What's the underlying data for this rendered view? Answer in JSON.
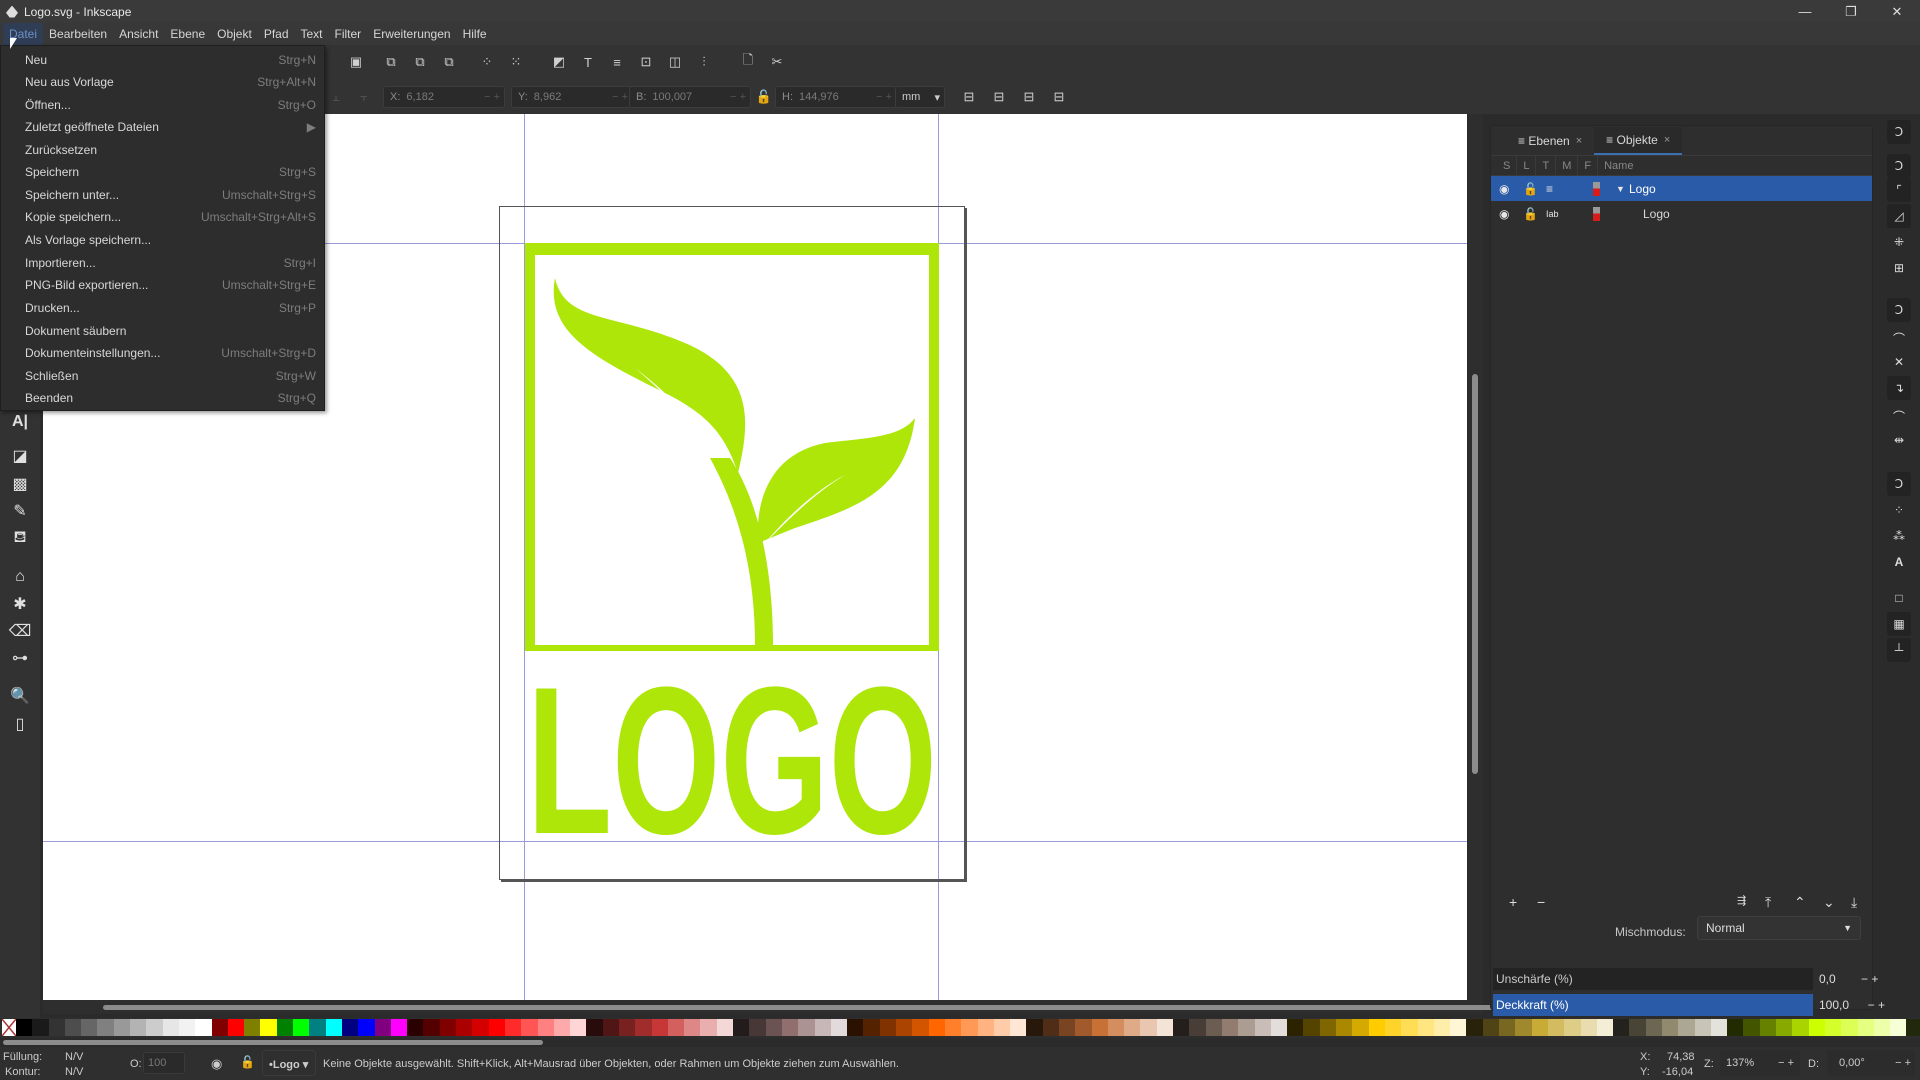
{
  "window": {
    "title": "Logo.svg - Inkscape",
    "controls": {
      "minimize": "—",
      "maximize": "❐",
      "close": "✕"
    }
  },
  "menubar": {
    "items": [
      "Datei",
      "Bearbeiten",
      "Ansicht",
      "Ebene",
      "Objekt",
      "Pfad",
      "Text",
      "Filter",
      "Erweiterungen",
      "Hilfe"
    ],
    "active": "Datei"
  },
  "file_menu": {
    "items": [
      {
        "label": "Neu",
        "shortcut": "Strg+N"
      },
      {
        "label": "Neu aus Vorlage",
        "shortcut": "Strg+Alt+N"
      },
      {
        "label": "Öffnen...",
        "shortcut": "Strg+O"
      },
      {
        "label": "Zuletzt geöffnete Dateien",
        "shortcut": "▶"
      },
      {
        "label": "Zurücksetzen",
        "shortcut": ""
      },
      {
        "label": "Speichern",
        "shortcut": "Strg+S"
      },
      {
        "label": "Speichern unter...",
        "shortcut": "Umschalt+Strg+S"
      },
      {
        "label": "Kopie speichern...",
        "shortcut": "Umschalt+Strg+Alt+S"
      },
      {
        "label": "Als Vorlage speichern...",
        "shortcut": ""
      },
      {
        "label": "Importieren...",
        "shortcut": "Strg+I"
      },
      {
        "label": "PNG-Bild exportieren...",
        "shortcut": "Umschalt+Strg+E"
      },
      {
        "label": "Drucken...",
        "shortcut": "Strg+P"
      },
      {
        "label": "Dokument säubern",
        "shortcut": ""
      },
      {
        "label": "Dokumenteinstellungen...",
        "shortcut": "Umschalt+Strg+D"
      },
      {
        "label": "Schließen",
        "shortcut": "Strg+W"
      },
      {
        "label": "Beenden",
        "shortcut": "Strg+Q"
      }
    ]
  },
  "toolbar": {
    "x_label": "X:",
    "x_value": "6,182",
    "y_label": "Y:",
    "y_value": "8,962",
    "w_label": "B:",
    "w_value": "100,007",
    "h_label": "H:",
    "h_value": "144,976",
    "unit": "mm"
  },
  "canvas": {
    "logo_text": "LOGO",
    "logo_color": "#aee60a"
  },
  "dock": {
    "tabs": [
      {
        "label": "Ebenen",
        "close": "×"
      },
      {
        "label": "Objekte",
        "close": "×"
      }
    ],
    "columns": [
      "S",
      "L",
      "T",
      "M",
      "F",
      "Name"
    ],
    "rows": [
      {
        "name": "Logo",
        "expanded": true,
        "selected": true,
        "type": "layer"
      },
      {
        "name": "Logo",
        "expanded": false,
        "selected": false,
        "type": "text"
      }
    ],
    "blend_label": "Mischmodus:",
    "blend_value": "Normal",
    "blur_label": "Unschärfe (%)",
    "blur_value": "0,0",
    "opacity_label": "Deckkraft (%)",
    "opacity_value": "100,0"
  },
  "status": {
    "fill_label": "Füllung:",
    "fill_value": "N/V",
    "stroke_label": "Kontur:",
    "stroke_value": "N/V",
    "opacity_label": "O:",
    "opacity_value": "100",
    "layer": "•Logo",
    "message": "Keine Objekte ausgewählt. Shift+Klick, Alt+Mausrad über Objekten, oder Rahmen um Objekte ziehen zum Auswählen.",
    "cursor_x_label": "X:",
    "cursor_x": "74,38",
    "cursor_y_label": "Y:",
    "cursor_y": "-16,04",
    "zoom_label": "Z:",
    "zoom": "137%",
    "rotation_label": "D:",
    "rotation": "0,00°"
  },
  "palette": [
    "#000000",
    "#1a1a1a",
    "#333333",
    "#4d4d4d",
    "#666666",
    "#808080",
    "#999999",
    "#b3b3b3",
    "#cccccc",
    "#e6e6e6",
    "#f2f2f2",
    "#ffffff",
    "#800000",
    "#ff0000",
    "#808000",
    "#ffff00",
    "#008000",
    "#00ff00",
    "#008080",
    "#00ffff",
    "#000080",
    "#0000ff",
    "#800080",
    "#ff00ff",
    "#2b0000",
    "#550000",
    "#800000",
    "#aa0000",
    "#d40000",
    "#ff0000",
    "#ff2a2a",
    "#ff5555",
    "#ff8080",
    "#ffaaaa",
    "#ffd5d5",
    "#280b0b",
    "#501616",
    "#782121",
    "#a02c2c",
    "#c83737",
    "#d35f5f",
    "#de8787",
    "#e9afaf",
    "#f4d7d7",
    "#241c1c",
    "#483737",
    "#6c5353",
    "#916f6f",
    "#ac9393",
    "#c8b7b7",
    "#e3dbdb",
    "#2b1100",
    "#552200",
    "#803300",
    "#aa4400",
    "#d45500",
    "#ff6600",
    "#ff7f2a",
    "#ff9955",
    "#ffb380",
    "#ffccaa",
    "#ffe6d5",
    "#28170b",
    "#502d16",
    "#784421",
    "#a05a2c",
    "#c87137",
    "#d38d5f",
    "#deaa87",
    "#e9c6af",
    "#f4e3d7",
    "#241f1c",
    "#483e37",
    "#6c5d53",
    "#917c6f",
    "#ac9d93",
    "#c8beb7",
    "#e3dedb",
    "#2b2200",
    "#554400",
    "#806600",
    "#aa8800",
    "#d4aa00",
    "#ffcc00",
    "#ffd42a",
    "#ffdd55",
    "#ffe680",
    "#ffeeaa",
    "#fff6d5",
    "#28220b",
    "#504416",
    "#786721",
    "#a0892c",
    "#c8ab37",
    "#d3bc5f",
    "#decd87",
    "#e9ddaf",
    "#f4eed7",
    "#24221c",
    "#484537",
    "#6c6753",
    "#918a6f",
    "#aca793",
    "#c8c4b7",
    "#e3e2db",
    "#222b00",
    "#445500",
    "#668000",
    "#88aa00",
    "#aad400",
    "#ccff00",
    "#d4ff2a",
    "#ddff55",
    "#e5ff80",
    "#eeffaa",
    "#f6ffd5",
    "#22280b",
    "#445016",
    "#677821",
    "#89a02c",
    "#abc837"
  ]
}
